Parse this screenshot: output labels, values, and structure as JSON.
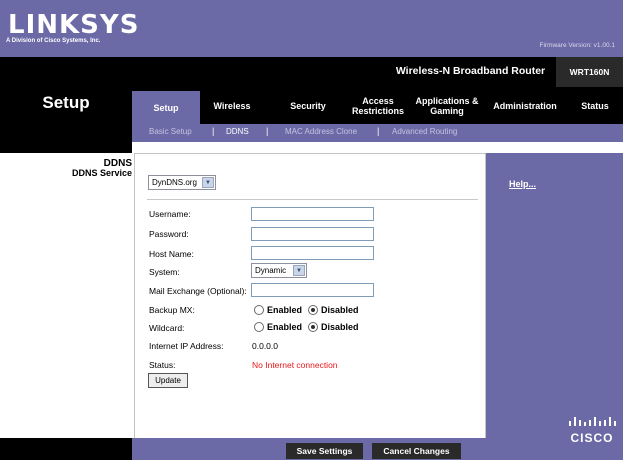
{
  "brand": {
    "logo": "LINKSYS",
    "subtitle": "A Division of Cisco Systems, Inc.",
    "firmware": "Firmware Version: v1.00.1",
    "product_name": "Wireless-N Broadband Router",
    "model": "WRT160N",
    "cisco": "CISCO"
  },
  "section_title": "Setup",
  "tabs": [
    {
      "label": "Setup"
    },
    {
      "label": "Wireless"
    },
    {
      "label": "Security"
    },
    {
      "label": "Access Restrictions"
    },
    {
      "label": "Applications & Gaming"
    },
    {
      "label": "Administration"
    },
    {
      "label": "Status"
    }
  ],
  "subtabs": [
    "Basic Setup",
    "DDNS",
    "MAC Address Clone",
    "Advanced Routing"
  ],
  "sidebar": {
    "heading": "DDNS",
    "item": "DDNS Service"
  },
  "form": {
    "service_select": "DynDNS.org",
    "username_label": "Username:",
    "password_label": "Password:",
    "hostname_label": "Host Name:",
    "system_label": "System:",
    "system_select": "Dynamic",
    "mail_exchange_label": "Mail Exchange (Optional):",
    "backup_mx_label": "Backup MX:",
    "wildcard_label": "Wildcard:",
    "enabled": "Enabled",
    "disabled": "Disabled",
    "ip_label": "Internet IP  Address:",
    "ip_value": "0.0.0.0",
    "status_label": "Status:",
    "status_value": "No Internet connection",
    "status_color": "#e8171b",
    "update_button": "Update"
  },
  "help": "Help...",
  "buttons": {
    "save": "Save Settings",
    "cancel": "Cancel Changes"
  },
  "colors": {
    "accent": "#6b6aa6",
    "header_dark": "#000000"
  }
}
